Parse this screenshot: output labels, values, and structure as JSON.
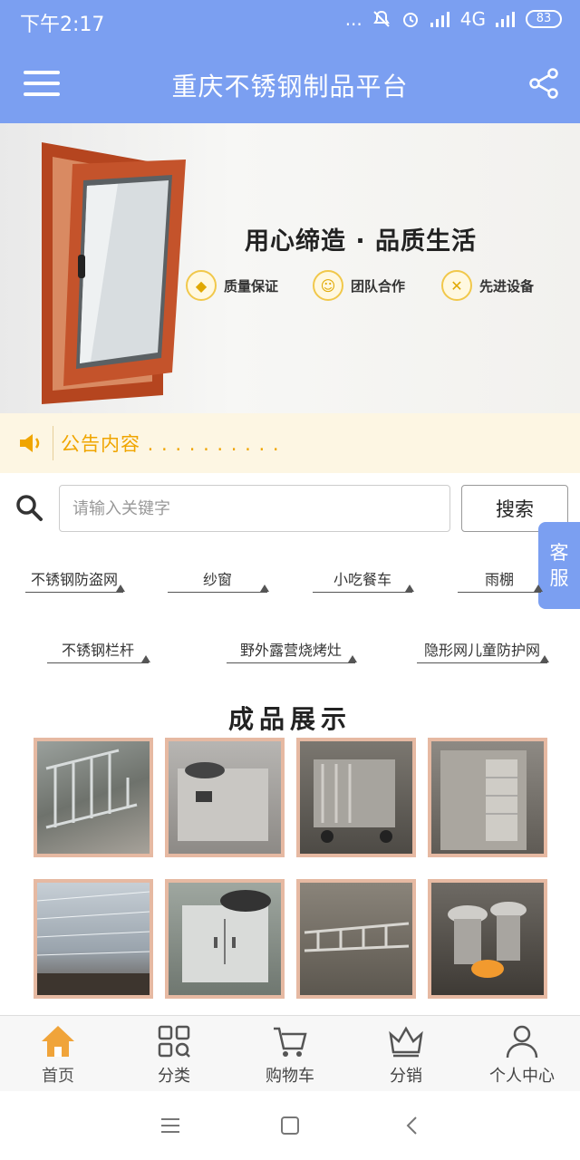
{
  "status_bar": {
    "time": "下午2:17",
    "dots": "...",
    "network": "4G",
    "battery": "83"
  },
  "header": {
    "title": "重庆不锈钢制品平台"
  },
  "banner": {
    "slogan": "用心缔造 · 品质生活",
    "features": [
      {
        "label": "质量保证",
        "icon": "diamond-icon"
      },
      {
        "label": "团队合作",
        "icon": "team-icon"
      },
      {
        "label": "先进设备",
        "icon": "tools-icon"
      }
    ]
  },
  "notice": {
    "text": "公告内容 . . . . . . . . . ."
  },
  "search": {
    "placeholder": "请输入关键字",
    "value": "",
    "button": "搜索"
  },
  "customer_service": {
    "line1": "客",
    "line2": "服"
  },
  "tags": [
    "不锈钢防盗网",
    "纱窗",
    "小吃餐车",
    "雨棚",
    "不锈钢栏杆",
    "野外露营烧烤灶",
    "隐形网儿童防护网"
  ],
  "section": {
    "title": "成品展示"
  },
  "tabbar": [
    {
      "label": "首页",
      "icon": "home-icon"
    },
    {
      "label": "分类",
      "icon": "category-icon"
    },
    {
      "label": "购物车",
      "icon": "cart-icon"
    },
    {
      "label": "分销",
      "icon": "crown-icon"
    },
    {
      "label": "个人中心",
      "icon": "user-icon"
    }
  ],
  "colors": {
    "primary": "#7b9ff1",
    "notice": "#f0a500",
    "active_tab": "#f0a43a"
  }
}
